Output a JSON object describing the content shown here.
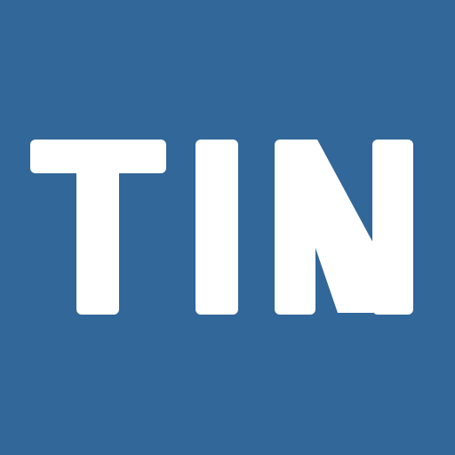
{
  "logo": {
    "text": "TIN",
    "background_color": "#316799",
    "foreground_color": "#ffffff"
  }
}
